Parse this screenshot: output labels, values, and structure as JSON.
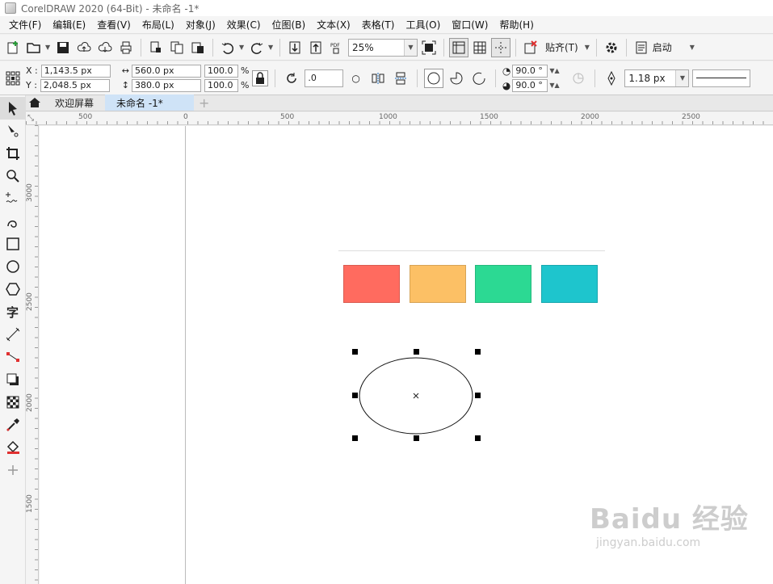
{
  "window": {
    "title": "CorelDRAW 2020 (64-Bit) - 未命名 -1*"
  },
  "menu": [
    "文件(F)",
    "编辑(E)",
    "查看(V)",
    "布局(L)",
    "对象(J)",
    "效果(C)",
    "位图(B)",
    "文本(X)",
    "表格(T)",
    "工具(O)",
    "窗口(W)",
    "帮助(H)"
  ],
  "toolbar": {
    "zoom": "25%",
    "snap_label": "贴齐(T)",
    "launch_label": "启动",
    "pdf_label": "PDF"
  },
  "properties": {
    "x_label": "X :",
    "x_value": "1,143.5 px",
    "y_label": "Y :",
    "y_value": "2,048.5 px",
    "width_value": "560.0 px",
    "height_value": "380.0 px",
    "scale_w": "100.0",
    "scale_h": "100.0",
    "percent": "%",
    "rotation": ".0",
    "start_angle": "90.0 °",
    "end_angle": "90.0 °",
    "outline_width": "1.18 px"
  },
  "tabs": {
    "welcome": "欢迎屏幕",
    "document": "未命名 -1*",
    "add": "+"
  },
  "ruler": {
    "h_ticks": [
      "500",
      "0",
      "500",
      "1000",
      "1500",
      "2000",
      "2500"
    ],
    "v_ticks": [
      "3000",
      "2500",
      "2000",
      "1500"
    ]
  },
  "swatches": [
    {
      "name": "red",
      "color": "#ff6b5f"
    },
    {
      "name": "orange",
      "color": "#fcc065"
    },
    {
      "name": "green",
      "color": "#2cd993"
    },
    {
      "name": "cyan",
      "color": "#1ec5cd"
    }
  ],
  "watermark": {
    "brand": "Baidu 经验",
    "url": "jingyan.baidu.com"
  }
}
